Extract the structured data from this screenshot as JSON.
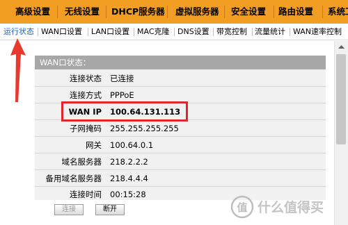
{
  "top_nav": [
    "高级设置",
    "无线设置",
    "DHCP服务器",
    "虚拟服务器",
    "安全设置",
    "路由设置",
    "系统工"
  ],
  "sub_nav": [
    "运行状态",
    "WAN口设置",
    "LAN口设置",
    "MAC克隆",
    "DNS设置",
    "带宽控制",
    "流量统计",
    "WAN速率控制"
  ],
  "panel": {
    "title": "WAN口状态：",
    "rows": [
      {
        "label": "连接状态",
        "value": "已连接"
      },
      {
        "label": "连接方式",
        "value": "PPPoE"
      },
      {
        "label": "WAN IP",
        "value": "100.64.131.113"
      },
      {
        "label": "子网掩码",
        "value": "255.255.255.255"
      },
      {
        "label": "网关",
        "value": "100.64.0.1"
      },
      {
        "label": "域名服务器",
        "value": "218.2.2.2"
      },
      {
        "label": "备用域名服务器",
        "value": "218.4.4.4"
      },
      {
        "label": "连接时间",
        "value": "00:15:28"
      }
    ]
  },
  "buttons": {
    "connect": "连接",
    "disconnect": "断开"
  },
  "colors": {
    "top_nav_bg": "#f29d24",
    "active_tab": "#1a5fcf",
    "highlight": "#e0262b",
    "arrow": "#e8392e"
  },
  "watermark": "值 什么值得买"
}
